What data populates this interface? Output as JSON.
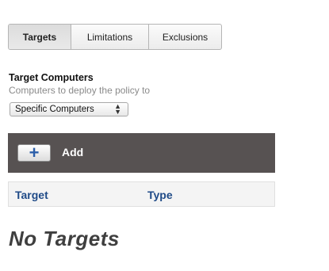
{
  "tabs": [
    {
      "label": "Targets",
      "active": true
    },
    {
      "label": "Limitations",
      "active": false
    },
    {
      "label": "Exclusions",
      "active": false
    }
  ],
  "section": {
    "title": "Target Computers",
    "subtitle": "Computers to deploy the policy to",
    "select_value": "Specific Computers"
  },
  "toolbar": {
    "add_label": "Add"
  },
  "table": {
    "columns": [
      "Target",
      "Type"
    ]
  },
  "empty_message": "No Targets",
  "colors": {
    "toolbar_bg": "#575252",
    "column_header_text": "#1f4a87",
    "add_icon": "#2b5ea9"
  }
}
